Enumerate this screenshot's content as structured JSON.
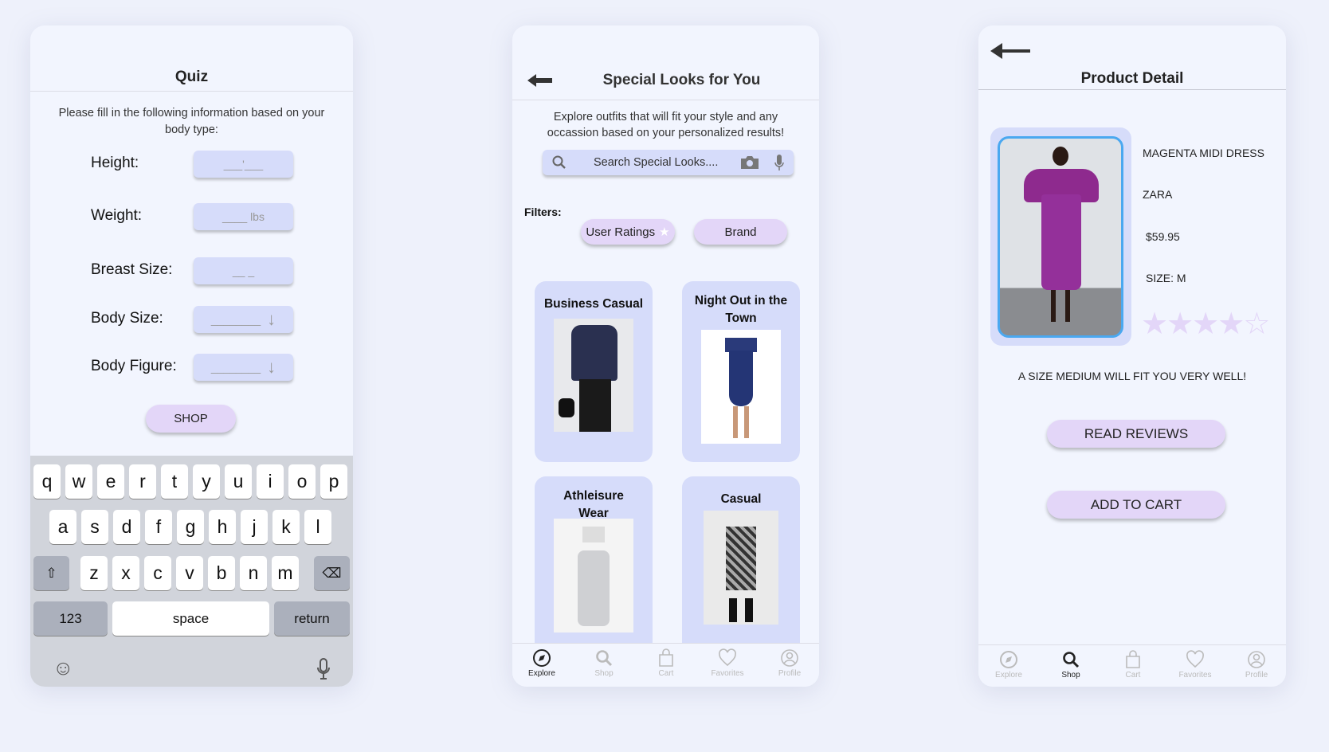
{
  "colors": {
    "background": "#eef1fb",
    "panel": "#f2f5fe",
    "field": "#d6dcfa",
    "button": "#e3d6f8",
    "accent_border": "#4aa8f0",
    "star": "#e3d6f8"
  },
  "quiz": {
    "title": "Quiz",
    "description": "Please fill in the following information based on your body type:",
    "fields": [
      {
        "label": "Height:",
        "placeholder": "___'___",
        "type": "text"
      },
      {
        "label": "Weight:",
        "placeholder": "____ lbs",
        "type": "text"
      },
      {
        "label": "Breast Size:",
        "placeholder": "__ _",
        "type": "text"
      },
      {
        "label": "Body Size:",
        "placeholder": "________",
        "type": "dropdown",
        "icon": "arrow-down-icon"
      },
      {
        "label": "Body Figure:",
        "placeholder": "________",
        "type": "dropdown",
        "icon": "arrow-down-icon"
      }
    ],
    "shop_button": "SHOP",
    "keyboard": {
      "row1": [
        "q",
        "w",
        "e",
        "r",
        "t",
        "y",
        "u",
        "i",
        "o",
        "p"
      ],
      "row2": [
        "a",
        "s",
        "d",
        "f",
        "g",
        "h",
        "j",
        "k",
        "l"
      ],
      "row3": [
        "z",
        "x",
        "c",
        "v",
        "b",
        "n",
        "m"
      ],
      "numbers": "123",
      "space": "space",
      "return": "return"
    }
  },
  "looks": {
    "title": "Special Looks for You",
    "description": "Explore outfits that will fit your style and any occassion based on your personalized results!",
    "search_placeholder": "Search Special Looks....",
    "filters_label": "Filters:",
    "filters": [
      "User Ratings",
      "Brand"
    ],
    "cards": [
      "Business Casual",
      "Night Out in the Town",
      "Athleisure Wear",
      "Casual"
    ],
    "nav": [
      {
        "label": "Explore",
        "icon": "compass-icon",
        "active": true
      },
      {
        "label": "Shop",
        "icon": "search-icon"
      },
      {
        "label": "Cart",
        "icon": "bag-icon"
      },
      {
        "label": "Favorites",
        "icon": "heart-icon"
      },
      {
        "label": "Profile",
        "icon": "profile-icon"
      }
    ]
  },
  "product": {
    "title": "Product Detail",
    "name": "MAGENTA MIDI DRESS",
    "brand": "ZARA",
    "price": "$59.95",
    "size": "SIZE: M",
    "rating": 4,
    "rating_max": 5,
    "fit_message": "A SIZE MEDIUM WILL FIT YOU VERY WELL!",
    "read_reviews": "READ REVIEWS",
    "add_to_cart": "ADD TO CART",
    "nav": [
      {
        "label": "Explore",
        "icon": "compass-icon"
      },
      {
        "label": "Shop",
        "icon": "search-icon",
        "active": true
      },
      {
        "label": "Cart",
        "icon": "bag-icon"
      },
      {
        "label": "Favorites",
        "icon": "heart-icon"
      },
      {
        "label": "Profile",
        "icon": "profile-icon"
      }
    ]
  }
}
